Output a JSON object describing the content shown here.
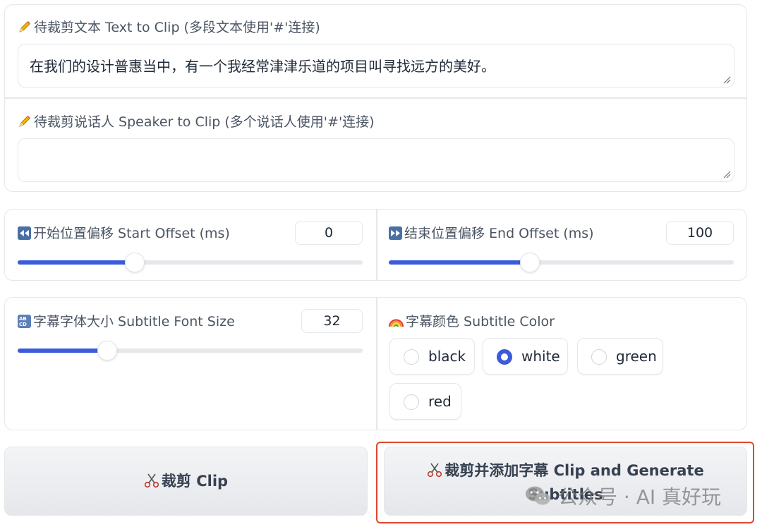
{
  "text_panel": {
    "text_label": "待裁剪文本 Text to Clip (多段文本使用'#'连接)",
    "text_value": "在我们的设计普惠当中，有一个我经常津津乐道的项目叫寻找远方的美好。",
    "speaker_label": "待裁剪说话人 Speaker to Clip (多个说话人使用'#'连接)",
    "speaker_value": ""
  },
  "offset_panel": {
    "start_label": "开始位置偏移 Start Offset (ms)",
    "start_value": "0",
    "start_fraction": 0.34,
    "end_label": "结束位置偏移 End Offset (ms)",
    "end_value": "100",
    "end_fraction": 0.41
  },
  "style_panel": {
    "font_size_label": "字幕字体大小 Subtitle Font Size",
    "font_size_value": "32",
    "font_size_fraction": 0.26,
    "color_label": "字幕颜色 Subtitle Color",
    "color_options": [
      "black",
      "white",
      "green",
      "red"
    ],
    "selected_color": "white"
  },
  "buttons": {
    "clip_label": "裁剪 Clip",
    "clip_subtitle_label_line1": "裁剪并添加字幕 Clip and Generate",
    "clip_subtitle_label_line2": "Subtitles"
  },
  "watermark": {
    "text": "公众号 · AI 真好玩"
  },
  "colors": {
    "accent": "#3b5bdb",
    "highlight": "#e0462e"
  }
}
